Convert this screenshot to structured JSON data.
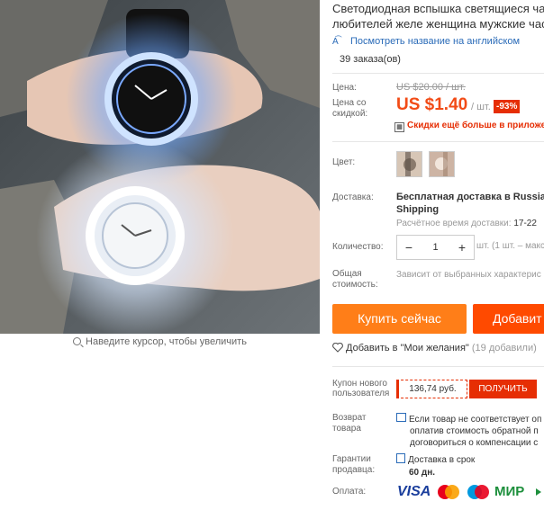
{
  "product": {
    "title_line1": "Светодиодная вспышка светящиеся час",
    "title_line2": "любителей желе женщина мужские часы"
  },
  "translate_link": "Посмотреть название на английском",
  "orders": "39 заказа(ов)",
  "price": {
    "label": "Цена:",
    "old": "US $20.00 / шт.",
    "discount_label": "Цена со скидкой:",
    "new": "US $1.40",
    "unit": "/ шт.",
    "badge": "-93%",
    "more_discounts": "Скидки ещё больше в приложе"
  },
  "color_label": "Цвет:",
  "shipping": {
    "label": "Доставка:",
    "line1": "Бесплатная доставка в Russian F",
    "line2": "Shipping",
    "time_label": "Расчётное время доставки:",
    "time_value": "17-22"
  },
  "quantity": {
    "label": "Количество:",
    "minus": "−",
    "value": "1",
    "plus": "+",
    "note": "шт. (1 шт. – макс"
  },
  "total": {
    "label": "Общая стоимость:",
    "note": "Зависит от выбранных характерис"
  },
  "buttons": {
    "buy": "Купить сейчас",
    "cart": "Добавит"
  },
  "wishlist": {
    "label": "Добавить в \"Мои желания\"",
    "count": "(19 добавили)"
  },
  "coupon": {
    "label_l1": "Купон нового",
    "label_l2": "пользователя",
    "value": "136,74 руб.",
    "button": "ПОЛУЧИТЬ"
  },
  "returns": {
    "label_l1": "Возврат",
    "label_l2": "товара",
    "line1": "Если товар не соответствует оп",
    "line2": "оплатив стоимость обратной п",
    "line3": "договориться о компенсации с"
  },
  "guarantee": {
    "label_l1": "Гарантии",
    "label_l2": "продавца:",
    "line1": "Доставка в срок",
    "line2": "60 дн."
  },
  "payment": {
    "label": "Оплата:",
    "visa": "VISA",
    "mir": "МИР"
  },
  "zoom_hint": "Наведите курсор, чтобы увеличить",
  "colors": {
    "accent_red": "#e62e04",
    "price_orange": "#f24b16",
    "buy_button": "#ff7e18",
    "cart_button": "#ff4a00",
    "link_blue": "#2a6bb8"
  }
}
